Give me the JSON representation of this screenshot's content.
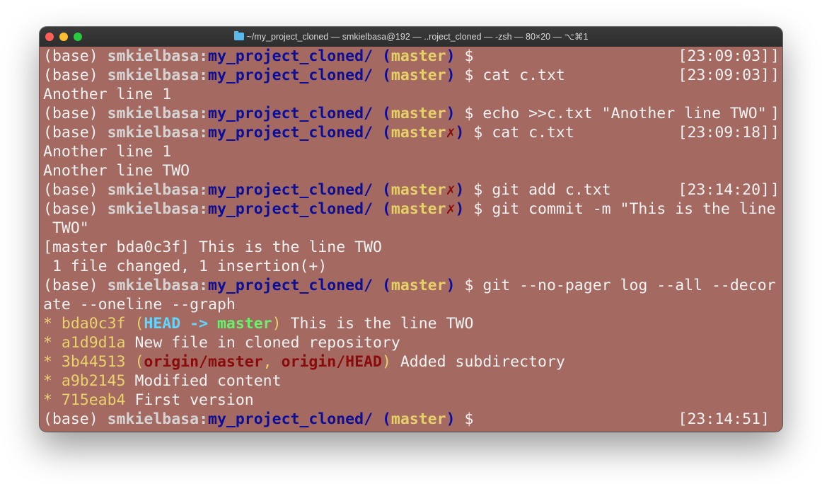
{
  "window": {
    "title": "~/my_project_cloned — smkielbasa@192 — ..roject_cloned — -zsh — 80×20 — ⌥⌘1",
    "folder_icon": "folder-icon",
    "traffic_lights": [
      "close",
      "minimize",
      "zoom"
    ]
  },
  "colors": {
    "background": "#a46a62",
    "directory": "#0b0e9b",
    "branch": "#e6d06a",
    "dirty_mark": "#8a0a0a",
    "head": "#5fd7ff",
    "local_branch": "#69f06d"
  },
  "prompt": {
    "env": "(base) ",
    "user": "smkielbasa",
    "colon": ":",
    "dir": "my_project_cloned/",
    "open_paren": " (",
    "branch": "master",
    "dirty": "✗",
    "close_paren": ")",
    "dollar": " $"
  },
  "lines": {
    "l1": {
      "cmd": "",
      "time": "[23:09:03]"
    },
    "l2": {
      "cmd": " cat c.txt",
      "time": "[23:09:03]"
    },
    "l3": {
      "text": "Another line 1"
    },
    "l4": {
      "cmd": " echo >>c.txt \"Another line TWO\""
    },
    "l5": {
      "cmd": " cat c.txt",
      "time": "[23:09:18]"
    },
    "l6": {
      "text": "Another line 1"
    },
    "l7": {
      "text": "Another line TWO"
    },
    "l8": {
      "cmd": " git add c.txt",
      "time": "[23:14:20]"
    },
    "l9": {
      "cmd": " git commit -m \"This is the line"
    },
    "l10": {
      "text": " TWO\""
    },
    "l11": {
      "text": "[master bda0c3f] This is the line TWO"
    },
    "l12": {
      "text": " 1 file changed, 1 insertion(+)"
    },
    "l13": {
      "cmd": " git --no-pager log --all --decor"
    },
    "l14": {
      "text": "ate --oneline --graph"
    },
    "l20": {
      "cmd": "",
      "time": "[23:14:51]"
    }
  },
  "log": [
    {
      "star": "* ",
      "hash": "bda0c3f",
      "message": " This is the line TWO"
    },
    {
      "star": "* ",
      "hash": "a1d9d1a",
      "message": " New file in cloned repository"
    },
    {
      "star": "* ",
      "hash": "3b44513",
      "message": " Added subdirectory"
    },
    {
      "star": "* ",
      "hash": "a9b2145",
      "message": " Modified content"
    },
    {
      "star": "* ",
      "hash": "715eab4",
      "message": " First version"
    }
  ],
  "decorations": {
    "d0": {
      "open": " (",
      "head": "HEAD",
      "arrow": " -> ",
      "branch": "master",
      "close": ")"
    },
    "d2": {
      "open": " (",
      "ref1": "origin/master",
      "sep": ", ",
      "ref2": "origin/HEAD",
      "close": ")"
    }
  },
  "right_bracket": "]"
}
